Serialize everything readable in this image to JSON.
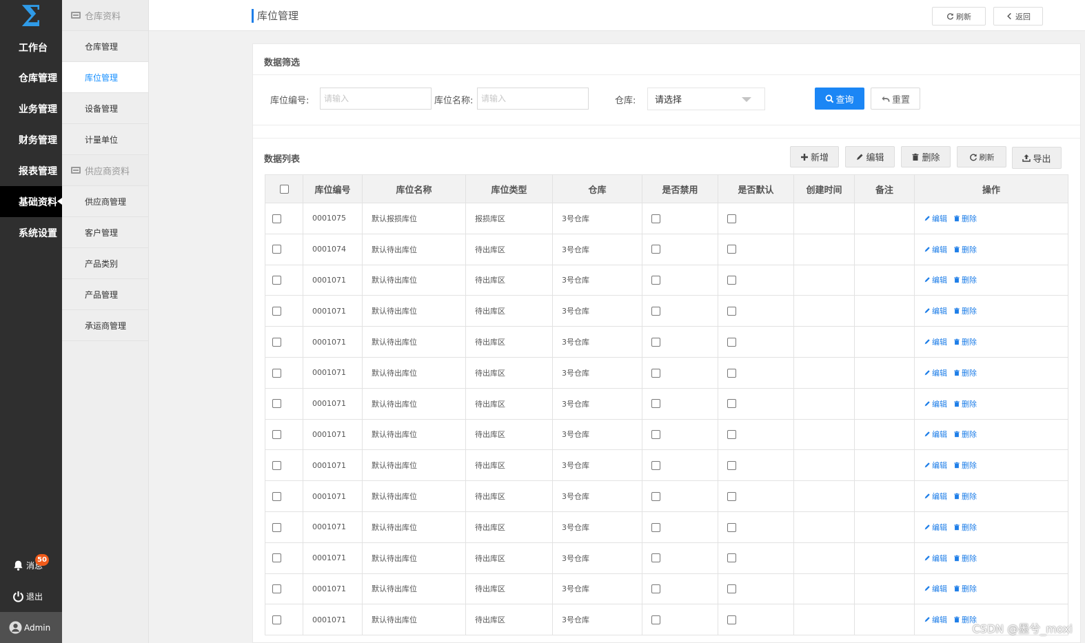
{
  "nav": {
    "logo": "Σ",
    "items": [
      {
        "label": "工作台"
      },
      {
        "label": "仓库管理"
      },
      {
        "label": "业务管理"
      },
      {
        "label": "财务管理"
      },
      {
        "label": "报表管理"
      },
      {
        "label": "基础资料"
      },
      {
        "label": "系统设置"
      }
    ],
    "active_index": 5,
    "messages_label": "消息",
    "messages_count": "50",
    "logout_label": "退出",
    "user_label": "Admin"
  },
  "subnav": {
    "group1": "仓库资料",
    "group1_items": [
      "仓库管理",
      "库位管理",
      "设备管理",
      "计量单位"
    ],
    "group2": "供应商资料",
    "group2_items": [
      "供应商管理",
      "客户管理",
      "产品类别",
      "产品管理",
      "承运商管理"
    ]
  },
  "header": {
    "title": "库位管理",
    "refresh_label": "刷新",
    "back_label": "返回"
  },
  "filter": {
    "title": "数据筛选",
    "code_label": "库位编号:",
    "code_placeholder": "请输入",
    "name_label": "库位名称:",
    "name_placeholder": "请输入",
    "warehouse_label": "仓库:",
    "warehouse_value": "请选择",
    "query_label": "查询",
    "reset_label": "重置"
  },
  "list": {
    "title": "数据列表",
    "add_label": "新增",
    "edit_label": "编辑",
    "delete_label": "删除",
    "refresh_label": "刷新",
    "export_label": "导出",
    "columns": [
      "库位编号",
      "库位名称",
      "库位类型",
      "仓库",
      "是否禁用",
      "是否默认",
      "创建时间",
      "备注",
      "操作"
    ],
    "row_edit": "编辑",
    "row_delete": "删除",
    "rows": [
      {
        "code": "0001075",
        "name": "默认报损库位",
        "type": "报损库区",
        "warehouse": "3号仓库"
      },
      {
        "code": "0001074",
        "name": "默认待出库位",
        "type": "待出库区",
        "warehouse": "3号仓库"
      },
      {
        "code": "0001071",
        "name": "默认待出库位",
        "type": "待出库区",
        "warehouse": "3号仓库"
      },
      {
        "code": "0001071",
        "name": "默认待出库位",
        "type": "待出库区",
        "warehouse": "3号仓库"
      },
      {
        "code": "0001071",
        "name": "默认待出库位",
        "type": "待出库区",
        "warehouse": "3号仓库"
      },
      {
        "code": "0001071",
        "name": "默认待出库位",
        "type": "待出库区",
        "warehouse": "3号仓库"
      },
      {
        "code": "0001071",
        "name": "默认待出库位",
        "type": "待出库区",
        "warehouse": "3号仓库"
      },
      {
        "code": "0001071",
        "name": "默认待出库位",
        "type": "待出库区",
        "warehouse": "3号仓库"
      },
      {
        "code": "0001071",
        "name": "默认待出库位",
        "type": "待出库区",
        "warehouse": "3号仓库"
      },
      {
        "code": "0001071",
        "name": "默认待出库位",
        "type": "待出库区",
        "warehouse": "3号仓库"
      },
      {
        "code": "0001071",
        "name": "默认待出库位",
        "type": "待出库区",
        "warehouse": "3号仓库"
      },
      {
        "code": "0001071",
        "name": "默认待出库位",
        "type": "待出库区",
        "warehouse": "3号仓库"
      },
      {
        "code": "0001071",
        "name": "默认待出库位",
        "type": "待出库区",
        "warehouse": "3号仓库"
      },
      {
        "code": "0001071",
        "name": "默认待出库位",
        "type": "待出库区",
        "warehouse": "3号仓库"
      }
    ]
  },
  "watermark": "CSDN @墨兮_moxi",
  "colors": {
    "accent": "#1b86f5",
    "nav_bg": "#2f2f2f",
    "badge": "#f05b1a"
  }
}
